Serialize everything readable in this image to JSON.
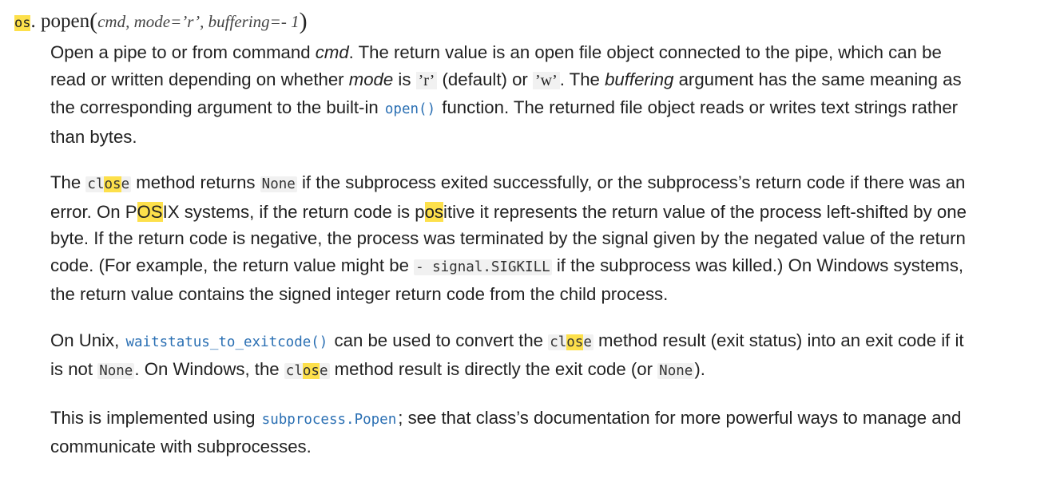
{
  "signature": {
    "module_prefix": "os",
    "dot": ".",
    "func_name": "popen",
    "open_paren": "(",
    "params": "cmd, mode=’r’, buffering=- 1",
    "close_paren": ")"
  },
  "p1": {
    "t1": "Open a pipe to or from command ",
    "e1": "cmd",
    "t2": ". The return value is an open file object connected to the pipe, which can be read or written depending on whether ",
    "e2": "mode",
    "t3": " is ",
    "c1": "’r’",
    "t4": " (default) or ",
    "c2": "’w’",
    "t5": ". The ",
    "e3": "buffering",
    "t6": " argument has the same meaning as the corresponding argument to the built-in ",
    "link1": "open()",
    "t7": " function. The returned file object reads or writes text strings rather than bytes."
  },
  "p2": {
    "t1": "The ",
    "cl_a": "cl",
    "cl_b": "os",
    "cl_c": "e",
    "t2": " method returns ",
    "none1": "None",
    "t3": " if the subprocess exited successfully, or the subprocess’s return code if there was an error. On P",
    "posix_hl": "OS",
    "t4": "IX systems, if the return code is p",
    "pos_hl": "os",
    "t5": "itive it represents the return value of the process left-shifted by one byte. If the return code is negative, the process was terminated by the signal given by the negated value of the return code. (For example, the return value might be ",
    "sig_code": "- signal.SIGKILL",
    "t6": " if the subprocess was killed.) On Windows systems, the return value contains the signed integer return code from the child process."
  },
  "p3": {
    "t1": "On Unix, ",
    "link1": "waitstatus_to_exitcode()",
    "t2": " can be used to convert the ",
    "cl_a": "cl",
    "cl_b": "os",
    "cl_c": "e",
    "t3": " method result (exit status) into an exit code if it is not ",
    "none1": "None",
    "t4": ". On Windows, the ",
    "cl2_a": "cl",
    "cl2_b": "os",
    "cl2_c": "e",
    "t5": " method result is directly the exit code (or ",
    "none2": "None",
    "t6": ")."
  },
  "p4": {
    "t1": "This is implemented using ",
    "link1": "subprocess.Popen",
    "t2": "; see that class’s documentation for more powerful ways to manage and communicate with subprocesses."
  },
  "colors": {
    "highlight": "#fde04b",
    "link": "#2a6fb3",
    "text": "#222222"
  }
}
